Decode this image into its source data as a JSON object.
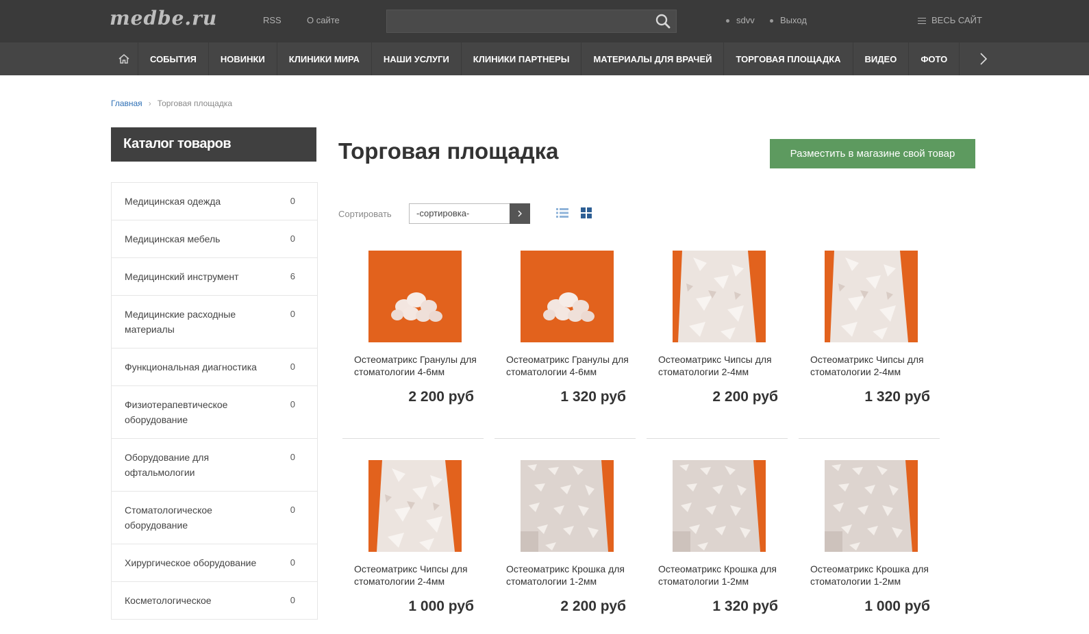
{
  "header": {
    "logo": "medbe.ru",
    "links": {
      "rss": "RSS",
      "about": "О сайте"
    },
    "search": {
      "placeholder": "",
      "value": ""
    },
    "user": {
      "name": "sdvv",
      "logout": "Выход"
    },
    "whole_site": "ВЕСЬ САЙТ"
  },
  "nav": {
    "items": [
      "СОБЫТИЯ",
      "НОВИНКИ",
      "КЛИНИКИ МИРА",
      "НАШИ УСЛУГИ",
      "КЛИНИКИ ПАРТНЕРЫ",
      "МАТЕРИАЛЫ ДЛЯ ВРАЧЕЙ",
      "ТОРГОВАЯ ПЛОЩАДКА",
      "ВИДЕО",
      "ФОТО"
    ]
  },
  "breadcrumb": {
    "home": "Главная",
    "current": "Торговая площадка"
  },
  "sidebar": {
    "title": "Каталог товаров",
    "items": [
      {
        "label": "Медицинская одежда",
        "count": "0"
      },
      {
        "label": "Медицинская мебель",
        "count": "0"
      },
      {
        "label": "Медицинский инструмент",
        "count": "6"
      },
      {
        "label": "Медицинские расходные материалы",
        "count": "0"
      },
      {
        "label": "Функциональная диагностика",
        "count": "0"
      },
      {
        "label": "Физиотерапевтическое оборудование",
        "count": "0"
      },
      {
        "label": "Оборудование для офтальмологии",
        "count": "0"
      },
      {
        "label": "Стоматологическое оборудование",
        "count": "0"
      },
      {
        "label": "Хирургическое оборудование",
        "count": "0"
      },
      {
        "label": "Косметологическое",
        "count": "0"
      }
    ]
  },
  "content": {
    "title": "Торговая площадка",
    "add_button": "Разместить в магазине свой товар",
    "sort_label": "Сортировать",
    "sort_value": "-сортировка-"
  },
  "products": [
    {
      "name": "Остеоматрикс Гранулы для стоматологии 4-6мм",
      "price": "2 200 руб",
      "image": "granules"
    },
    {
      "name": "Остеоматрикс Гранулы для стоматологии 4-6мм",
      "price": "1 320 руб",
      "image": "granules"
    },
    {
      "name": "Остеоматрикс Чипсы для стоматологии 2-4мм",
      "price": "2 200 руб",
      "image": "chips"
    },
    {
      "name": "Остеоматрикс Чипсы для стоматологии 2-4мм",
      "price": "1 320 руб",
      "image": "chips"
    },
    {
      "name": "Остеоматрикс Чипсы для стоматологии 2-4мм",
      "price": "1 000 руб",
      "image": "chips"
    },
    {
      "name": "Остеоматрикс Крошка для стоматологии 1-2мм",
      "price": "2 200 руб",
      "image": "crumbs"
    },
    {
      "name": "Остеоматрикс Крошка для стоматологии 1-2мм",
      "price": "1 320 руб",
      "image": "crumbs"
    },
    {
      "name": "Остеоматрикс Крошка для стоматологии 1-2мм",
      "price": "1 000 руб",
      "image": "crumbs"
    }
  ],
  "colors": {
    "topbar": "#3a3a3a",
    "nav": "#454545",
    "accent_green": "#5d9a5f",
    "link_blue": "#2d6fb5",
    "product_bg_orange": "#e2621d"
  }
}
